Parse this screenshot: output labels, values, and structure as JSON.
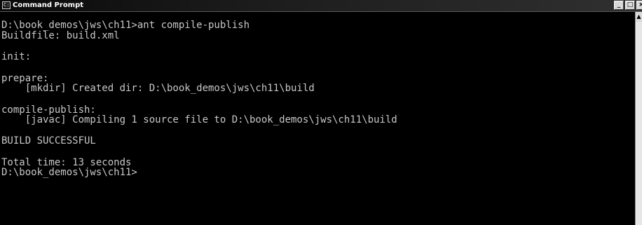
{
  "window": {
    "title": "Command Prompt",
    "icon": "console-icon",
    "buttons": {
      "minimize": "_",
      "maximize": "□",
      "close": "×"
    }
  },
  "console": {
    "lines": [
      "D:\\book_demos\\jws\\ch11>ant compile-publish",
      "Buildfile: build.xml",
      "init:",
      "prepare:",
      "    [mkdir] Created dir: D:\\book_demos\\jws\\ch11\\build",
      "compile-publish:",
      "    [javac] Compiling 1 source file to D:\\book_demos\\jws\\ch11\\build",
      "BUILD SUCCESSFUL",
      "Total time: 13 seconds",
      "D:\\book_demos\\jws\\ch11>"
    ]
  },
  "scrollbar": {
    "up_arrow": "▲"
  },
  "colors": {
    "console_background": "#000000",
    "console_text": "#c8c8c8",
    "titlebar_text": "#ffffff"
  }
}
